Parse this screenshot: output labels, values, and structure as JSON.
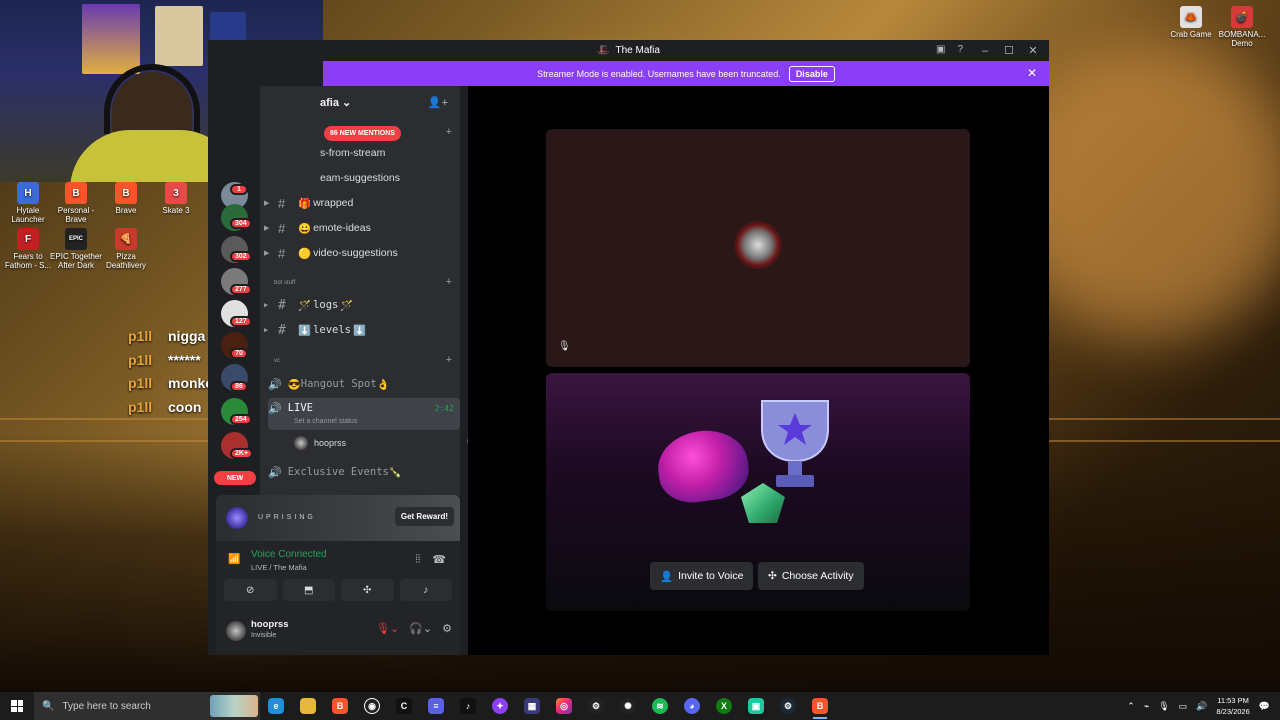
{
  "window": {
    "title": "The Mafia",
    "streamer_banner": "Streamer Mode is enabled. Usernames have been truncated.",
    "disable_label": "Disable"
  },
  "desktop_icons": [
    {
      "label": "Crab Game",
      "color": "#e0e0e0"
    },
    {
      "label": "BOMBANA... Demo",
      "color": "#d83a3a"
    },
    {
      "label": "Hytale Launcher",
      "color": "#3a6bd8"
    },
    {
      "label": "Personal - Brave",
      "color": "#fb542b"
    },
    {
      "label": "Brave",
      "color": "#fb542b"
    },
    {
      "label": "Skate 3",
      "color": "#e84a4a"
    },
    {
      "label": "Fears to Fathom - S...",
      "color": "#c22020"
    },
    {
      "label": "EPIC Together After Dark",
      "color": "#222222"
    },
    {
      "label": "Pizza Deathlivery",
      "color": "#c83a2a"
    }
  ],
  "chat": [
    {
      "user": "p1ll",
      "message": "nigga"
    },
    {
      "user": "p1ll",
      "message": "******"
    },
    {
      "user": "p1ll",
      "message": "monkey"
    },
    {
      "user": "p1ll",
      "message": "coon"
    }
  ],
  "server": {
    "name": "afia",
    "new_mentions": "86 NEW MENTIONS",
    "new_label": "NEW",
    "badges": [
      "1",
      "304",
      "302",
      "277",
      "127",
      "70",
      "86",
      "254",
      "2K+"
    ]
  },
  "channels": {
    "text": [
      {
        "name": "s-from-stream",
        "prefix": ""
      },
      {
        "name": "eam-suggestions",
        "prefix": ""
      },
      {
        "name": "wrapped",
        "prefix": "🎁"
      },
      {
        "name": "emote-ideas",
        "prefix": "😀"
      },
      {
        "name": "video-suggestions",
        "prefix": "🟡"
      }
    ],
    "cat_bot": "bot stuff",
    "bot": [
      {
        "name": "logs",
        "prefix": "🪄",
        "suffix": "🪄"
      },
      {
        "name": "levels",
        "prefix": "⬇️",
        "suffix": "⬇️"
      }
    ],
    "cat_vc": "vc",
    "voice": [
      {
        "name": "Hangout Spot",
        "prefix": "😎",
        "suffix": "👌"
      },
      {
        "name": "LIVE",
        "timer": "2:42",
        "status": "Set a channel status"
      },
      {
        "name": "Exclusive Events",
        "suffix": "🍾"
      }
    ],
    "voice_member": "hooprss"
  },
  "promo": {
    "word": "UPRISING",
    "button": "Get Reward!"
  },
  "voice_panel": {
    "status": "Voice Connected",
    "location": "LIVE / The Mafia"
  },
  "user": {
    "name": "hooprss",
    "status": "Invisible"
  },
  "activity": {
    "invite_label": "Invite to Voice",
    "choose_label": "Choose Activity"
  },
  "taskbar": {
    "search_placeholder": "Type here to search",
    "time": "11:53 PM",
    "date": "8/23/2026"
  }
}
